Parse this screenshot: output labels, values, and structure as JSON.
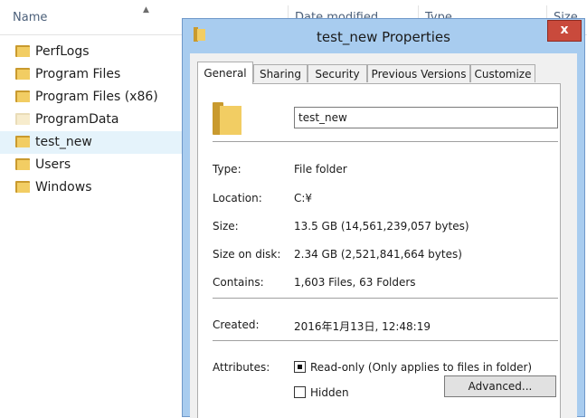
{
  "explorer": {
    "columns": {
      "name": "Name",
      "date_modified": "Date modified",
      "type": "Type",
      "size": "Size"
    },
    "items": [
      {
        "name": "PerfLogs"
      },
      {
        "name": "Program Files"
      },
      {
        "name": "Program Files (x86)"
      },
      {
        "name": "ProgramData"
      },
      {
        "name": "test_new",
        "selected": true
      },
      {
        "name": "Users"
      },
      {
        "name": "Windows"
      }
    ]
  },
  "dialog": {
    "title": "test_new Properties",
    "close_label": "x",
    "tabs": [
      "General",
      "Sharing",
      "Security",
      "Previous Versions",
      "Customize"
    ],
    "active_tab": "General",
    "folder_name": "test_new",
    "fields": {
      "type": {
        "label": "Type:",
        "value": "File folder"
      },
      "location": {
        "label": "Location:",
        "value": "C:¥"
      },
      "size": {
        "label": "Size:",
        "value": "13.5 GB (14,561,239,057 bytes)"
      },
      "size_on_disk": {
        "label": "Size on disk:",
        "value": "2.34 GB (2,521,841,664 bytes)"
      },
      "contains": {
        "label": "Contains:",
        "value": "1,603 Files, 63 Folders"
      },
      "created": {
        "label": "Created:",
        "value": "2016年1月13日, 12:48:19"
      }
    },
    "attributes": {
      "label": "Attributes:",
      "read_only": {
        "label": "Read-only (Only applies to files in folder)",
        "checked": "indeterminate"
      },
      "hidden": {
        "label": "Hidden",
        "checked": false
      },
      "advanced_label": "Advanced..."
    }
  },
  "colors": {
    "dialog_frame": "#a8ccef",
    "close_button": "#c94a3c",
    "selection": "#e5f3fb",
    "folder": "#f2cd63"
  }
}
